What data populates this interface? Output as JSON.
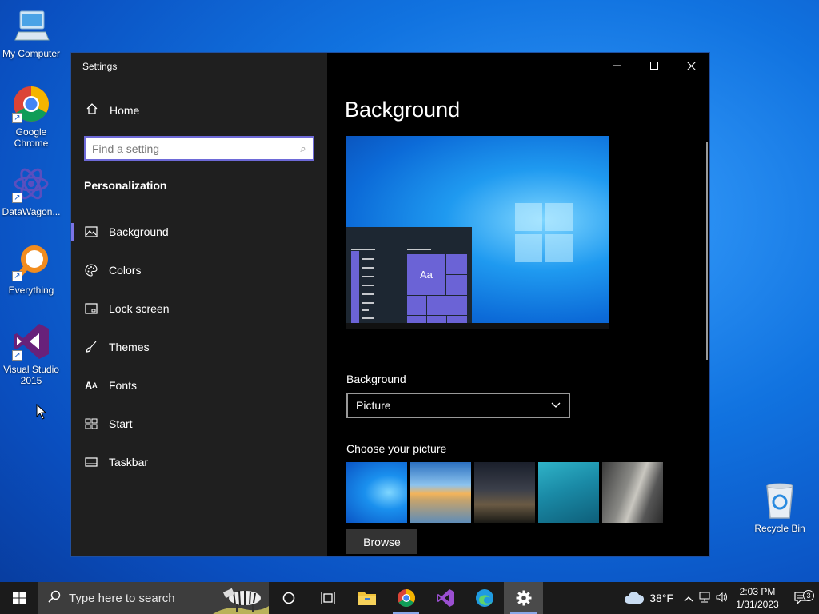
{
  "desktop": {
    "icons": [
      {
        "label": "My Computer"
      },
      {
        "label": "Google Chrome"
      },
      {
        "label": "DataWagon..."
      },
      {
        "label": "Everything"
      },
      {
        "label": "Visual Studio 2015"
      },
      {
        "label": "Recycle Bin"
      }
    ]
  },
  "window": {
    "title": "Settings",
    "controls": {
      "minimize": "—",
      "maximize": "☐",
      "close": "✕"
    }
  },
  "sidebar": {
    "home_label": "Home",
    "search_placeholder": "Find a setting",
    "section_title": "Personalization",
    "items": [
      {
        "label": "Background",
        "icon": "image-icon",
        "selected": true
      },
      {
        "label": "Colors",
        "icon": "palette-icon"
      },
      {
        "label": "Lock screen",
        "icon": "lock-screen-icon"
      },
      {
        "label": "Themes",
        "icon": "brush-icon"
      },
      {
        "label": "Fonts",
        "icon": "fonts-icon"
      },
      {
        "label": "Start",
        "icon": "start-icon"
      },
      {
        "label": "Taskbar",
        "icon": "taskbar-icon"
      }
    ]
  },
  "content": {
    "title": "Background",
    "preview_tile_label": "Aa",
    "background_label": "Background",
    "background_value": "Picture",
    "choose_picture_label": "Choose your picture",
    "browse_label": "Browse"
  },
  "taskbar": {
    "search_placeholder": "Type here to search",
    "weather": "38°F",
    "time": "2:03 PM",
    "date": "1/31/2023",
    "notification_count": "3"
  },
  "colors": {
    "accent": "#7b74e6",
    "sidebar_bg": "#1f1f1f",
    "content_bg": "#000000",
    "taskbar_bg": "#1b1b1b"
  }
}
